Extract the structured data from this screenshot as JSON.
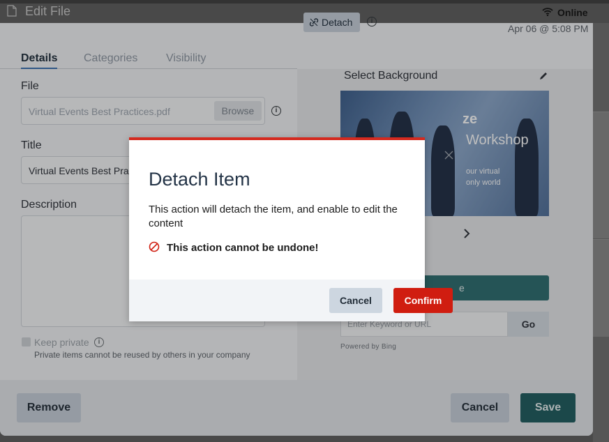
{
  "window": {
    "title": "Edit File"
  },
  "tabs": [
    {
      "label": "Details",
      "active": true
    },
    {
      "label": "Categories",
      "active": false
    },
    {
      "label": "Visibility",
      "active": false
    }
  ],
  "form": {
    "file_label": "File",
    "file_value": "Virtual Events Best Practices.pdf",
    "browse_label": "Browse",
    "title_label": "Title",
    "title_value": "Virtual Events Best Practices",
    "description_label": "Description",
    "description_value": "",
    "keep_private_label": "Keep private",
    "keep_private_checked": false,
    "keep_private_note": "Private items cannot be reused by others in your company"
  },
  "header": {
    "detach_label": "Detach",
    "status": "Online",
    "date": "Apr 06 @ 5:08 PM"
  },
  "background": {
    "label": "Select Background",
    "image_text_1": "ze",
    "image_text_2": "Workshop",
    "image_text_3": "our virtual",
    "image_text_4": "only world",
    "teal_button_label": "e",
    "keyword_placeholder": "Enter Keyword or URL",
    "go_label": "Go",
    "powered_by": "Powered by Bing"
  },
  "footer": {
    "remove_label": "Remove",
    "cancel_label": "Cancel",
    "save_label": "Save"
  },
  "modal": {
    "title": "Detach Item",
    "body": "This action will detach the item, and enable to edit the content",
    "warning": "This action cannot be undone!",
    "cancel_label": "Cancel",
    "confirm_label": "Confirm"
  },
  "colors": {
    "accent_red": "#d01d10",
    "teal": "#1e5c5f",
    "tab_active_underline": "#3a6fb0"
  },
  "icons": [
    "document-icon",
    "info-icon",
    "link-icon",
    "wifi-icon",
    "pencil-icon",
    "chevron-right-icon",
    "close-icon",
    "prohibited-icon"
  ]
}
